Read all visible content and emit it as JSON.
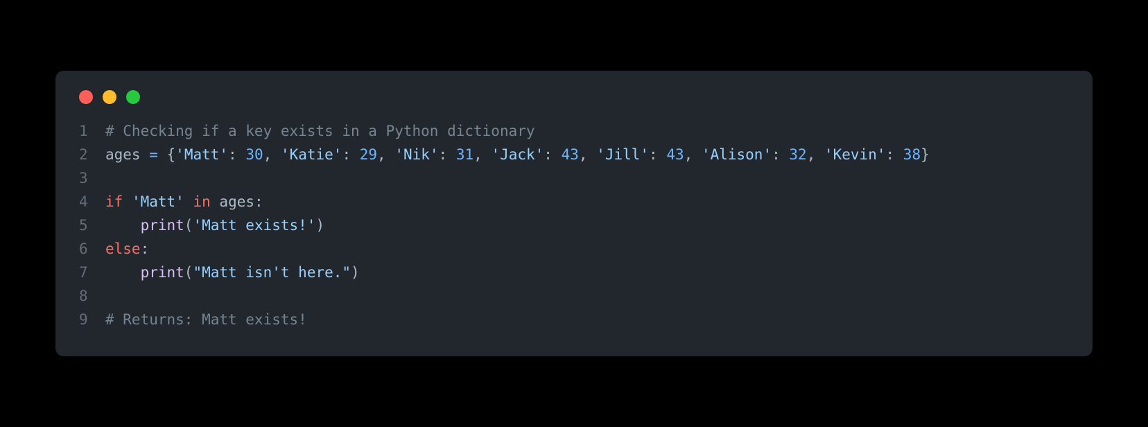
{
  "lines": {
    "l1_num": "1",
    "l1_comment": "# Checking if a key exists in a Python dictionary",
    "l2_num": "2",
    "l2_ident": "ages",
    "l2_eq": " = ",
    "l2_b_open": "{",
    "l2_k1": "'Matt'",
    "l2_c1": ": ",
    "l2_v1": "30",
    "l2_s1": ", ",
    "l2_k2": "'Katie'",
    "l2_c2": ": ",
    "l2_v2": "29",
    "l2_s2": ", ",
    "l2_k3": "'Nik'",
    "l2_c3": ": ",
    "l2_v3": "31",
    "l2_s3": ", ",
    "l2_k4": "'Jack'",
    "l2_c4": ": ",
    "l2_v4": "43",
    "l2_s4": ", ",
    "l2_k5": "'Jill'",
    "l2_c5": ": ",
    "l2_v5": "43",
    "l2_s5": ", ",
    "l2_k6": "'Alison'",
    "l2_c6": ": ",
    "l2_v6": "32",
    "l2_s6": ", ",
    "l2_k7": "'Kevin'",
    "l2_c7": ": ",
    "l2_v7": "38",
    "l2_b_close": "}",
    "l3_num": "3",
    "l4_num": "4",
    "l4_if": "if",
    "l4_sp1": " ",
    "l4_str": "'Matt'",
    "l4_sp2": " ",
    "l4_in": "in",
    "l4_sp3": " ",
    "l4_ident": "ages",
    "l4_colon": ":",
    "l5_num": "5",
    "l5_indent": "    ",
    "l5_func": "print",
    "l5_p_open": "(",
    "l5_str": "'Matt exists!'",
    "l5_p_close": ")",
    "l6_num": "6",
    "l6_else": "else",
    "l6_colon": ":",
    "l7_num": "7",
    "l7_indent": "    ",
    "l7_func": "print",
    "l7_p_open": "(",
    "l7_str": "\"Matt isn't here.\"",
    "l7_p_close": ")",
    "l8_num": "8",
    "l9_num": "9",
    "l9_comment": "# Returns: Matt exists!"
  }
}
